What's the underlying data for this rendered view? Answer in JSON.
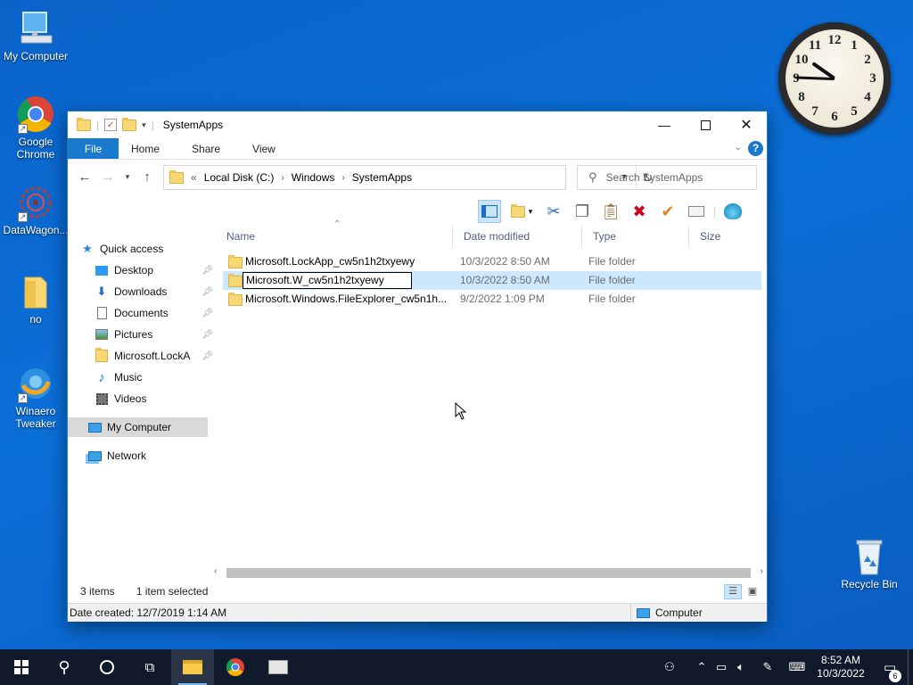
{
  "desktop": {
    "icons": [
      {
        "label": "My Computer"
      },
      {
        "label": "Google Chrome"
      },
      {
        "label": "DataWagon..."
      },
      {
        "label": "no"
      },
      {
        "label": "Winaero Tweaker"
      },
      {
        "label": "Recycle Bin"
      }
    ]
  },
  "clock": {
    "numbers": [
      "12",
      "1",
      "2",
      "3",
      "4",
      "5",
      "6",
      "7",
      "8",
      "9",
      "10",
      "11"
    ]
  },
  "window": {
    "title": "SystemApps",
    "ribbon_tabs": [
      "File",
      "Home",
      "Share",
      "View"
    ],
    "help_label": "?",
    "address": {
      "overflow": "«",
      "crumbs": [
        "Local Disk (C:)",
        "Windows",
        "SystemApps"
      ]
    },
    "search_placeholder": "Search SystemApps",
    "nav": {
      "quick_access": "Quick access",
      "items": [
        "Desktop",
        "Downloads",
        "Documents",
        "Pictures",
        "Microsoft.LockA",
        "Music",
        "Videos"
      ],
      "my_computer": "My Computer",
      "network": "Network"
    },
    "columns": [
      "Name",
      "Date modified",
      "Type",
      "Size"
    ],
    "files": [
      {
        "name": "Microsoft.LockApp_cw5n1h2txyewy",
        "date": "10/3/2022 8:50 AM",
        "type": "File folder"
      },
      {
        "name": "Microsoft.W_cw5n1h2txyewy",
        "date": "10/3/2022 8:50 AM",
        "type": "File folder"
      },
      {
        "name": "Microsoft.Windows.FileExplorer_cw5n1h...",
        "date": "9/2/2022 1:09 PM",
        "type": "File folder"
      }
    ],
    "status": {
      "count": "3 items",
      "selection": "1 item selected"
    },
    "details": {
      "date_created": "Date created: 12/7/2019 1:14 AM",
      "location": "Computer"
    }
  },
  "taskbar": {
    "time": "8:52 AM",
    "date": "10/3/2022",
    "notifications": "6"
  },
  "colors": {
    "accent": "#1979ca",
    "selection": "#cce8ff",
    "taskbar": "#101a2a"
  }
}
